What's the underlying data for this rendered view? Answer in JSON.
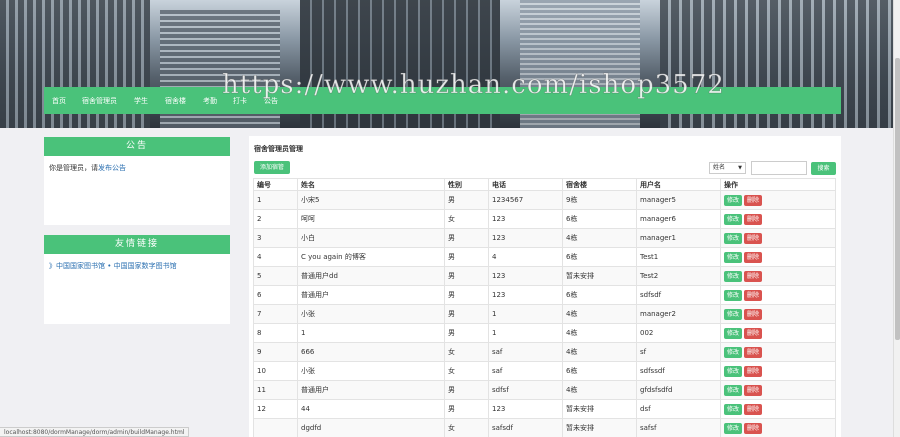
{
  "banner": {
    "watermark": "https://www.huzhan.com/ishop3572"
  },
  "nav": [
    {
      "label": "首页"
    },
    {
      "label": "宿舍管理员"
    },
    {
      "label": "学生"
    },
    {
      "label": "宿舍楼"
    },
    {
      "label": "考勤"
    },
    {
      "label": "打卡"
    },
    {
      "label": "公告"
    }
  ],
  "notice_panel": {
    "title": "公告",
    "text": "你是管理员，请",
    "link": "发布公告"
  },
  "links_panel": {
    "title": "友情链接",
    "text": "》中国国家图书馆 • 中国国家数字图书馆"
  },
  "main": {
    "title": "宿舍管理员管理",
    "add_button": "添加宿管",
    "search_select": "姓名",
    "search_input": "",
    "search_button": "搜索",
    "columns": [
      "编号",
      "姓名",
      "性别",
      "电话",
      "宿舍楼",
      "用户名",
      "操作"
    ],
    "edit_label": "修改",
    "delete_label": "删除",
    "rows": [
      {
        "id": "1",
        "name": "小宋5",
        "sex": "男",
        "phone": "1234567",
        "building": "9栋",
        "username": "manager5"
      },
      {
        "id": "2",
        "name": "呵呵",
        "sex": "女",
        "phone": "123",
        "building": "6栋",
        "username": "manager6"
      },
      {
        "id": "3",
        "name": "小白",
        "sex": "男",
        "phone": "123",
        "building": "4栋",
        "username": "manager1"
      },
      {
        "id": "4",
        "name": "C you again 的博客",
        "sex": "男",
        "phone": "4",
        "building": "6栋",
        "username": "Test1"
      },
      {
        "id": "5",
        "name": "普通用户dd",
        "sex": "男",
        "phone": "123",
        "building": "暂未安排",
        "username": "Test2"
      },
      {
        "id": "6",
        "name": "普通用户",
        "sex": "男",
        "phone": "123",
        "building": "6栋",
        "username": "sdfsdf"
      },
      {
        "id": "7",
        "name": "小张",
        "sex": "男",
        "phone": "1",
        "building": "4栋",
        "username": "manager2"
      },
      {
        "id": "8",
        "name": "1",
        "sex": "男",
        "phone": "1",
        "building": "4栋",
        "username": "002"
      },
      {
        "id": "9",
        "name": "666",
        "sex": "女",
        "phone": "saf",
        "building": "4栋",
        "username": "sf"
      },
      {
        "id": "10",
        "name": "小张",
        "sex": "女",
        "phone": "saf",
        "building": "6栋",
        "username": "sdfssdf"
      },
      {
        "id": "11",
        "name": "普通用户",
        "sex": "男",
        "phone": "sdfsf",
        "building": "4栋",
        "username": "gfdsfsdfd"
      },
      {
        "id": "12",
        "name": "44",
        "sex": "男",
        "phone": "123",
        "building": "暂未安排",
        "username": "dsf"
      },
      {
        "id": "",
        "name": "dgdfd",
        "sex": "女",
        "phone": "safsdf",
        "building": "暂未安排",
        "username": "safsf"
      }
    ]
  },
  "statusbar": {
    "url": "localhost:8080/dormManage/dorm/admin/buildManage.html"
  },
  "colors": {
    "accent": "#4ac27a",
    "danger": "#d9534f"
  }
}
